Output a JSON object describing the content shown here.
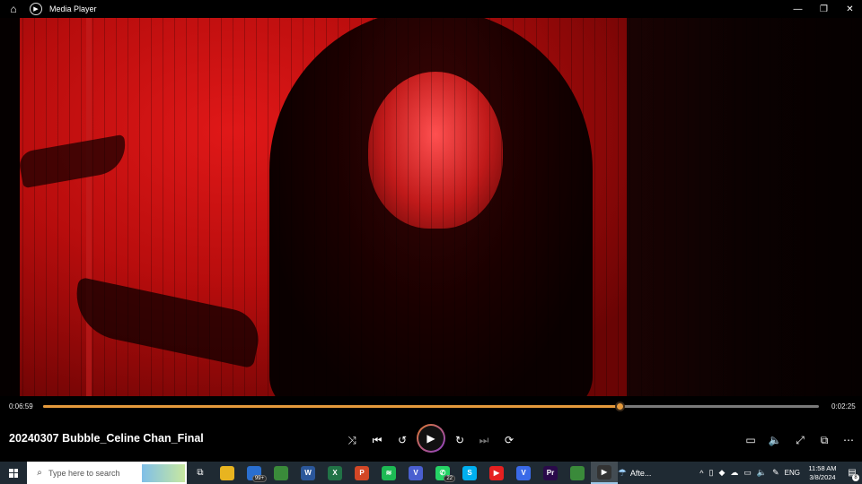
{
  "window": {
    "title": "Media Player",
    "home_icon": "⌂",
    "app_icon": "▶",
    "minimize": "—",
    "maximize": "❐",
    "close": "✕"
  },
  "player": {
    "elapsed": "0:06:59",
    "remaining": "0:02:25",
    "progress_fraction": 0.743,
    "media_title": "20240307 Bubble_Celine Chan_Final",
    "buttons": {
      "shuffle": "⤨",
      "previous": "⏮",
      "skip_back": "↺",
      "play": "▶",
      "skip_forward": "↻",
      "next": "⏭",
      "repeat": "⟳",
      "captions": "▭",
      "volume": "🔈",
      "fullscreen": "⤢",
      "miniplayer": "⧉",
      "more": "⋯"
    },
    "accent_color": "#e59a3c"
  },
  "taskbar": {
    "search_placeholder": "Type here to search",
    "search_icon": "⌕",
    "task_view_icon": "⧉",
    "apps": [
      {
        "name": "file-explorer",
        "label": "",
        "color": "#e8b420",
        "badge": ""
      },
      {
        "name": "outlook",
        "label": "",
        "color": "#2a6fd0",
        "badge": "99+"
      },
      {
        "name": "chrome",
        "label": "",
        "color": "#3a8a3a",
        "badge": ""
      },
      {
        "name": "word",
        "label": "W",
        "color": "#2b579a",
        "badge": ""
      },
      {
        "name": "excel",
        "label": "X",
        "color": "#217346",
        "badge": ""
      },
      {
        "name": "powerpoint",
        "label": "P",
        "color": "#d24726",
        "badge": ""
      },
      {
        "name": "spotify",
        "label": "≋",
        "color": "#1db954",
        "badge": ""
      },
      {
        "name": "vpn",
        "label": "V",
        "color": "#4a5fd0",
        "badge": ""
      },
      {
        "name": "whatsapp",
        "label": "✆",
        "color": "#25d366",
        "badge": "22"
      },
      {
        "name": "skype",
        "label": "S",
        "color": "#00aff0",
        "badge": ""
      },
      {
        "name": "youtube",
        "label": "▶",
        "color": "#e52020",
        "badge": ""
      },
      {
        "name": "vegas",
        "label": "V",
        "color": "#3a6ae8",
        "badge": ""
      },
      {
        "name": "premiere",
        "label": "Pr",
        "color": "#2a0a4a",
        "badge": ""
      },
      {
        "name": "chrome-2",
        "label": "",
        "color": "#3a8a3a",
        "badge": ""
      },
      {
        "name": "media-player",
        "label": "▶",
        "color": "#333333",
        "badge": ""
      }
    ],
    "weather_text": "Afte...",
    "weather_icon": "☂",
    "tray": {
      "chevron": "^",
      "language": "ENG",
      "time": "11:58 AM",
      "date": "3/8/2024",
      "notification_count": "8"
    }
  }
}
